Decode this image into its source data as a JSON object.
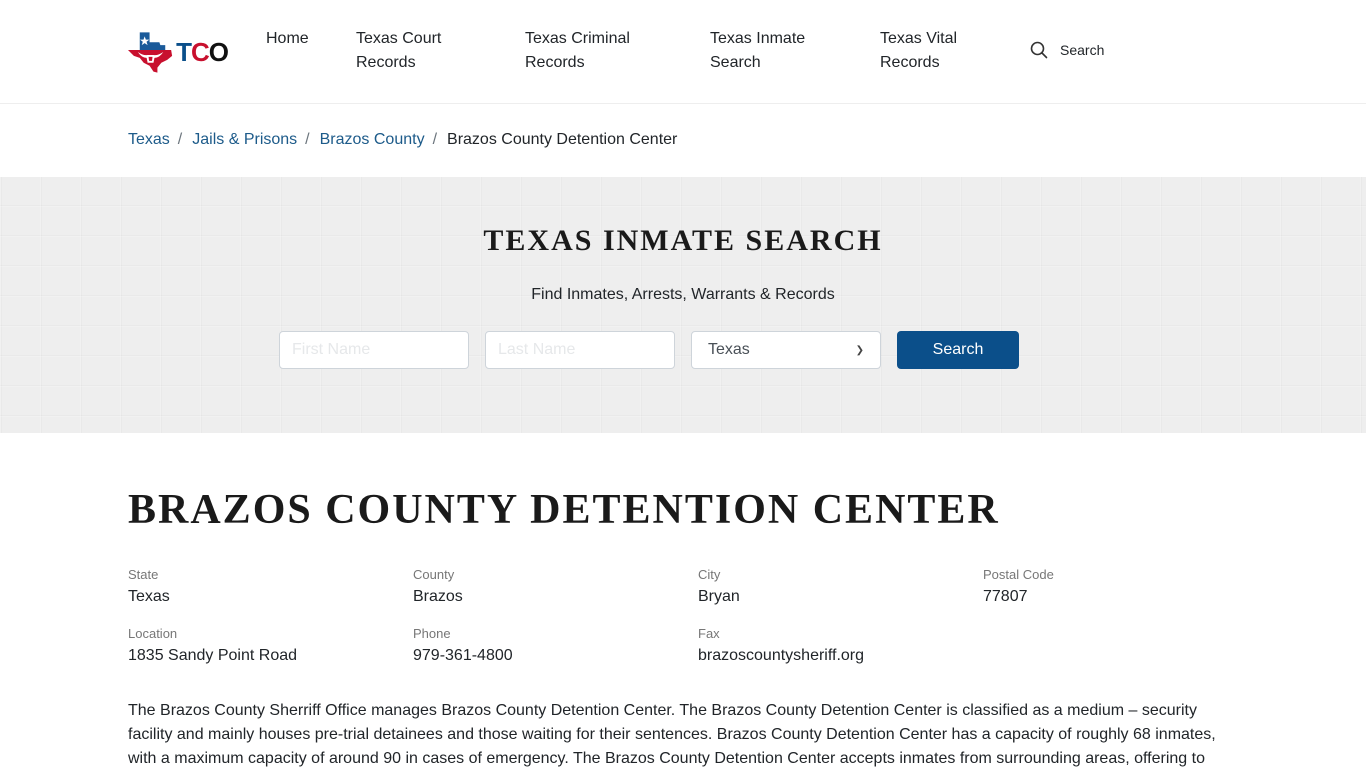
{
  "header": {
    "logo_text": {
      "t": "T",
      "c": "C",
      "o": "O"
    },
    "logo_icon": "texas-flag-longhorn-logo",
    "nav": [
      {
        "line1": "Home",
        "line2": ""
      },
      {
        "line1": "Texas Court",
        "line2": "Records"
      },
      {
        "line1": "Texas Criminal",
        "line2": "Records"
      },
      {
        "line1": "Texas Inmate",
        "line2": "Search"
      },
      {
        "line1": "Texas Vital",
        "line2": "Records"
      }
    ],
    "search_label": "Search",
    "search_icon": "search-icon"
  },
  "breadcrumb": {
    "items": [
      "Texas",
      "Jails & Prisons",
      "Brazos County"
    ],
    "separator": "/",
    "current": "Brazos County Detention Center"
  },
  "search_band": {
    "title": "TEXAS INMATE SEARCH",
    "subtitle": "Find Inmates, Arrests, Warrants & Records",
    "first_name_placeholder": "First Name",
    "first_name_value": "",
    "last_name_placeholder": "Last Name",
    "last_name_value": "",
    "state_selected": "Texas",
    "button_label": "Search",
    "button_color": "#0b4f8a"
  },
  "facility": {
    "title": "BRAZOS COUNTY DETENTION CENTER",
    "fields": [
      {
        "label": "State",
        "value": "Texas"
      },
      {
        "label": "County",
        "value": "Brazos"
      },
      {
        "label": "City",
        "value": "Bryan"
      },
      {
        "label": "Postal Code",
        "value": "77807"
      },
      {
        "label": "Location",
        "value": "1835 Sandy Point Road"
      },
      {
        "label": "Phone",
        "value": "979-361-4800"
      },
      {
        "label": "Fax",
        "value": "brazoscountysheriff.org"
      }
    ],
    "description": "The Brazos County Sherriff Office manages Brazos County Detention Center. The Brazos County Detention Center is classified as a medium – security facility and mainly houses pre-trial detainees and those waiting for their sentences. Brazos County Detention Center has a capacity of roughly 68 inmates, with a maximum capacity of around 90 in cases of emergency. The Brazos County Detention Center accepts inmates from surrounding areas, offering to"
  },
  "colors": {
    "link": "#1d5b8a",
    "brand_blue": "#0a4f8a",
    "brand_red": "#c8102e"
  }
}
